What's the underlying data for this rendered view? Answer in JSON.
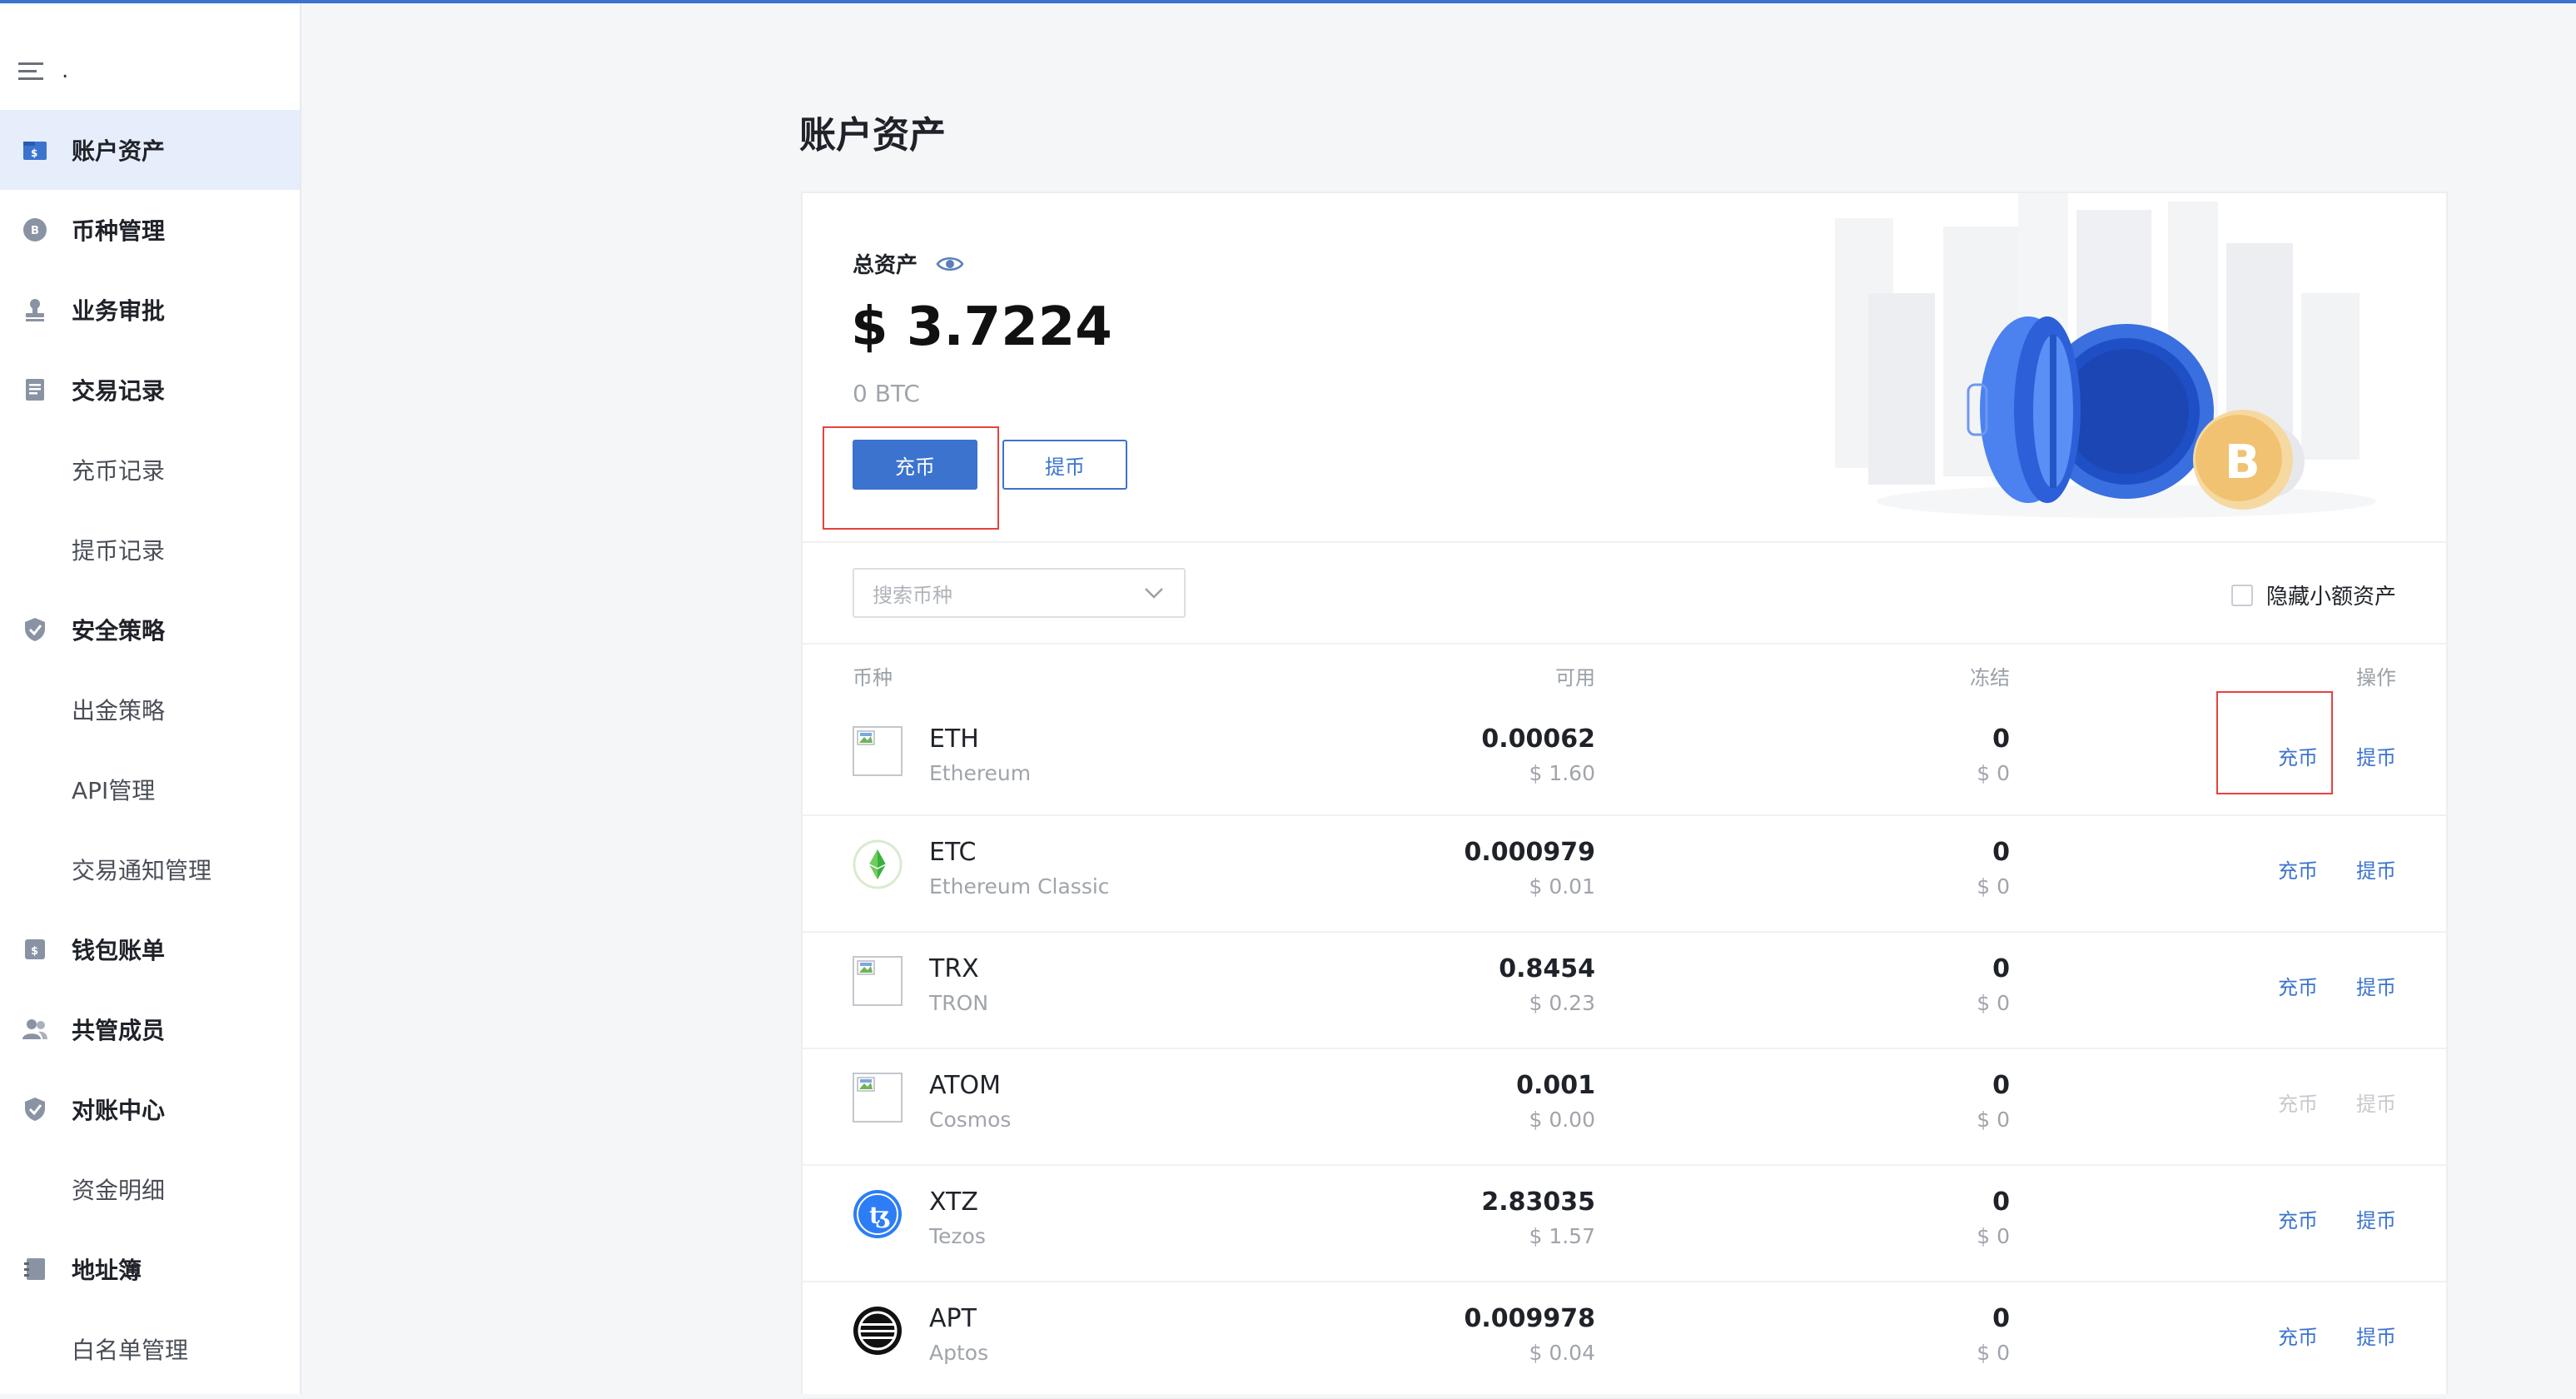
{
  "sidebar": {
    "menu_dot": ".",
    "items": [
      {
        "label": "账户资产",
        "icon": "wallet-dollar-icon",
        "active": true,
        "sub": false
      },
      {
        "label": "币种管理",
        "icon": "coin-icon",
        "sub": false
      },
      {
        "label": "业务审批",
        "icon": "stamp-icon",
        "sub": false
      },
      {
        "label": "交易记录",
        "icon": "document-icon",
        "sub": false
      },
      {
        "label": "充币记录",
        "sub": true
      },
      {
        "label": "提币记录",
        "sub": true
      },
      {
        "label": "安全策略",
        "icon": "shield-check-icon",
        "sub": false
      },
      {
        "label": "出金策略",
        "sub": true
      },
      {
        "label": "API管理",
        "sub": true
      },
      {
        "label": "交易通知管理",
        "sub": true
      },
      {
        "label": "钱包账单",
        "icon": "bill-icon",
        "sub": false
      },
      {
        "label": "共管成员",
        "icon": "users-icon",
        "sub": false
      },
      {
        "label": "对账中心",
        "icon": "shield-check-icon",
        "sub": false
      },
      {
        "label": "资金明细",
        "sub": true
      },
      {
        "label": "地址簿",
        "icon": "address-book-icon",
        "sub": false
      },
      {
        "label": "白名单管理",
        "sub": true
      }
    ]
  },
  "page": {
    "title": "账户资产"
  },
  "summary": {
    "total_label": "总资产",
    "total_value": "$ 3.7224",
    "total_btc": "0 BTC",
    "deposit_label": "充币",
    "withdraw_label": "提币"
  },
  "filter": {
    "search_placeholder": "搜索币种",
    "hide_small_label": "隐藏小额资产"
  },
  "table": {
    "headers": {
      "coin": "币种",
      "available": "可用",
      "frozen": "冻结",
      "action": "操作"
    },
    "rows": [
      {
        "symbol": "ETH",
        "name": "Ethereum",
        "available": "0.00062",
        "available_usd": "$ 1.60",
        "frozen": "0",
        "frozen_usd": "$ 0",
        "icon": "broken-image-icon",
        "deposit": "充币",
        "withdraw": "提币",
        "enabled": true
      },
      {
        "symbol": "ETC",
        "name": "Ethereum Classic",
        "available": "0.000979",
        "available_usd": "$ 0.01",
        "frozen": "0",
        "frozen_usd": "$ 0",
        "icon": "etc-logo-icon",
        "deposit": "充币",
        "withdraw": "提币",
        "enabled": true
      },
      {
        "symbol": "TRX",
        "name": "TRON",
        "available": "0.8454",
        "available_usd": "$ 0.23",
        "frozen": "0",
        "frozen_usd": "$ 0",
        "icon": "broken-image-icon",
        "deposit": "充币",
        "withdraw": "提币",
        "enabled": true
      },
      {
        "symbol": "ATOM",
        "name": "Cosmos",
        "available": "0.001",
        "available_usd": "$ 0.00",
        "frozen": "0",
        "frozen_usd": "$ 0",
        "icon": "broken-image-icon",
        "deposit": "充币",
        "withdraw": "提币",
        "enabled": false
      },
      {
        "symbol": "XTZ",
        "name": "Tezos",
        "available": "2.83035",
        "available_usd": "$ 1.57",
        "frozen": "0",
        "frozen_usd": "$ 0",
        "icon": "tezos-logo-icon",
        "deposit": "充币",
        "withdraw": "提币",
        "enabled": true
      },
      {
        "symbol": "APT",
        "name": "Aptos",
        "available": "0.009978",
        "available_usd": "$ 0.04",
        "frozen": "0",
        "frozen_usd": "$ 0",
        "icon": "aptos-logo-icon",
        "deposit": "充币",
        "withdraw": "提币",
        "enabled": true
      }
    ]
  },
  "colors": {
    "accent": "#3b73cf",
    "highlight_box": "#e8413c",
    "active_nav_bg": "#e7eefb"
  }
}
